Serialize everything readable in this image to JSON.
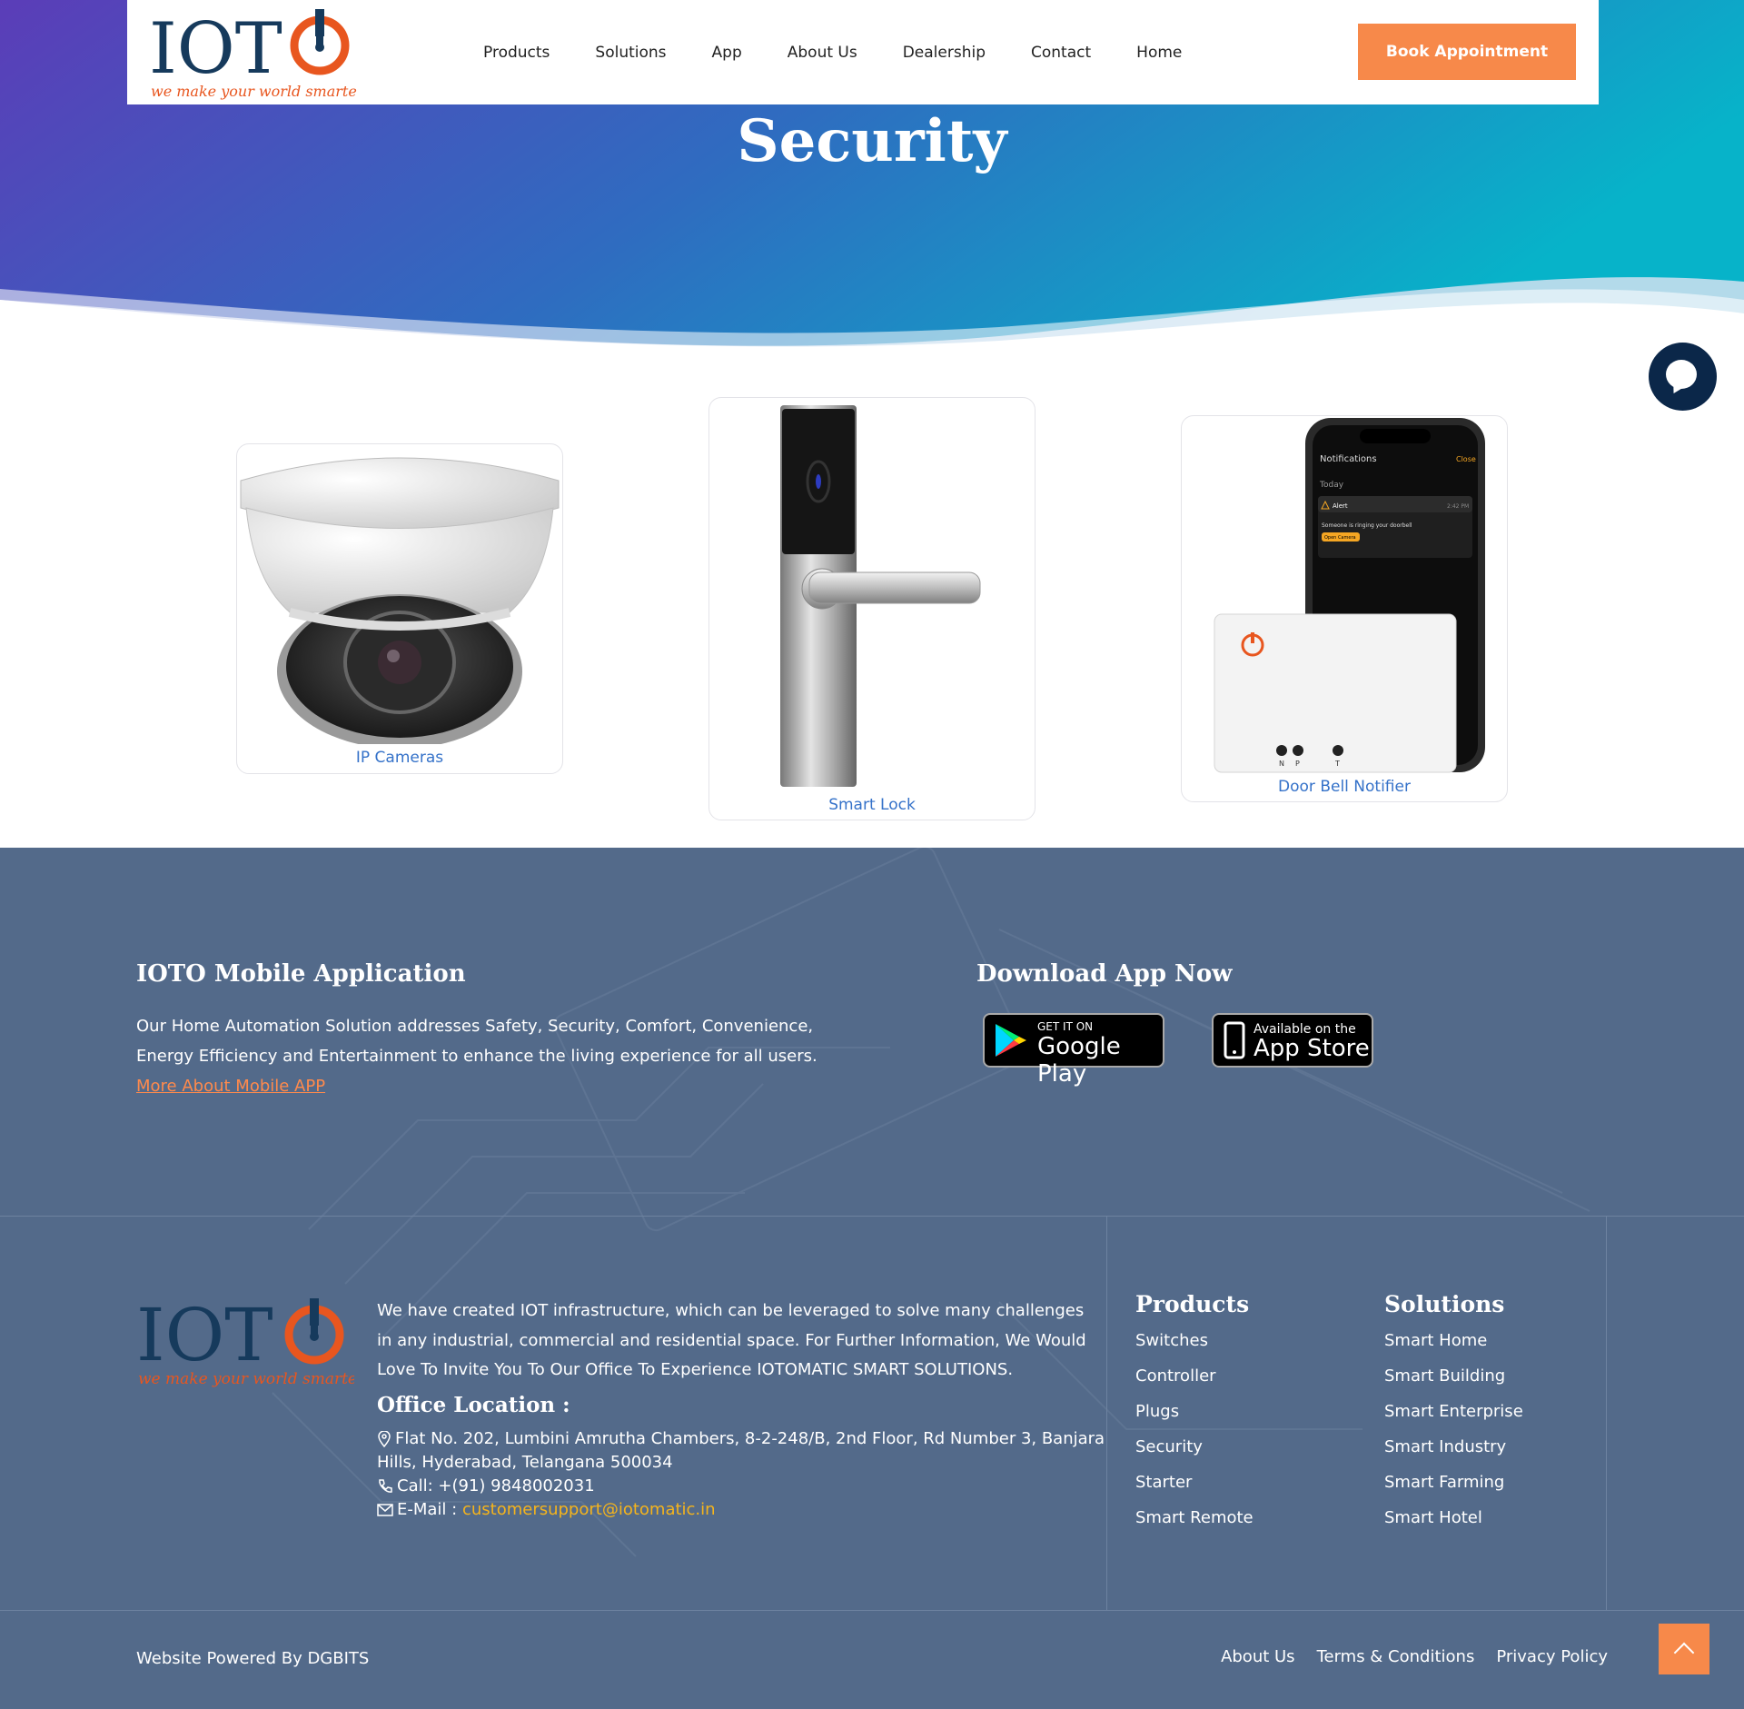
{
  "brand": {
    "logo_text": "IOT",
    "tagline": "we make your world smarter"
  },
  "nav": {
    "items": [
      "Products",
      "Solutions",
      "App",
      "About Us",
      "Dealership",
      "Contact",
      "Home"
    ],
    "cta": "Book Appointment"
  },
  "hero": {
    "title": "Security"
  },
  "products": [
    {
      "label": "IP Cameras"
    },
    {
      "label": "Smart Lock"
    },
    {
      "label": "Door Bell Notifier"
    }
  ],
  "phone_mock": {
    "title": "Notifications",
    "close": "Close",
    "today": "Today",
    "alert": "Alert",
    "time": "2:42 PM",
    "message": "Someone is ringing your doorbell",
    "button": "Open Camera",
    "ports": [
      "N",
      "P",
      "T"
    ]
  },
  "footer": {
    "app_heading": "IOTO Mobile Application",
    "app_text_1": "Our Home Automation Solution addresses Safety, Security, Comfort, Convenience,",
    "app_text_2": "Energy Efficiency and Entertainment to enhance the living experience for all users.",
    "app_link": "More About Mobile APP",
    "download_heading": "Download App Now",
    "google_small": "GET IT ON",
    "google_big": "Google Play",
    "apple_small": "Available on the",
    "apple_big": "App Store",
    "about_1": "We have created IOT infrastructure, which can be leveraged to solve many challenges",
    "about_2": "in any industrial, commercial and residential space. For Further Information, We Would",
    "about_3": "Love To Invite You To Our Office To Experience IOTOMATIC SMART SOLUTIONS.",
    "office_heading": "Office Location :",
    "address_1": "Flat No. 202, Lumbini Amrutha Chambers, 8-2-248/B, 2nd Floor, Rd Number 3, Banjara",
    "address_2": "Hills, Hyderabad, Telangana 500034",
    "call": "Call: +(91) 9848002031",
    "email_label": "E-Mail :",
    "email": "customersupport@iotomatic.in",
    "products_heading": "Products",
    "products_links": [
      "Switches",
      "Controller",
      "Plugs",
      "Security",
      "Starter",
      "Smart Remote"
    ],
    "solutions_heading": "Solutions",
    "solutions_links": [
      "Smart Home",
      "Smart Building",
      "Smart Enterprise",
      "Smart Industry",
      "Smart Farming",
      "Smart Hotel"
    ],
    "powered": "Website Powered By DGBITS",
    "bottom_links": [
      "About Us",
      "Terms & Conditions",
      "Privacy Policy"
    ]
  },
  "colors": {
    "accent": "#f7894a",
    "footer_bg": "#536a8a",
    "hero_start": "#5a3fb8",
    "hero_end": "#0ab0c9",
    "link_blue": "#3572c9",
    "logo_navy": "#163a5c",
    "logo_orange": "#e8561f"
  }
}
